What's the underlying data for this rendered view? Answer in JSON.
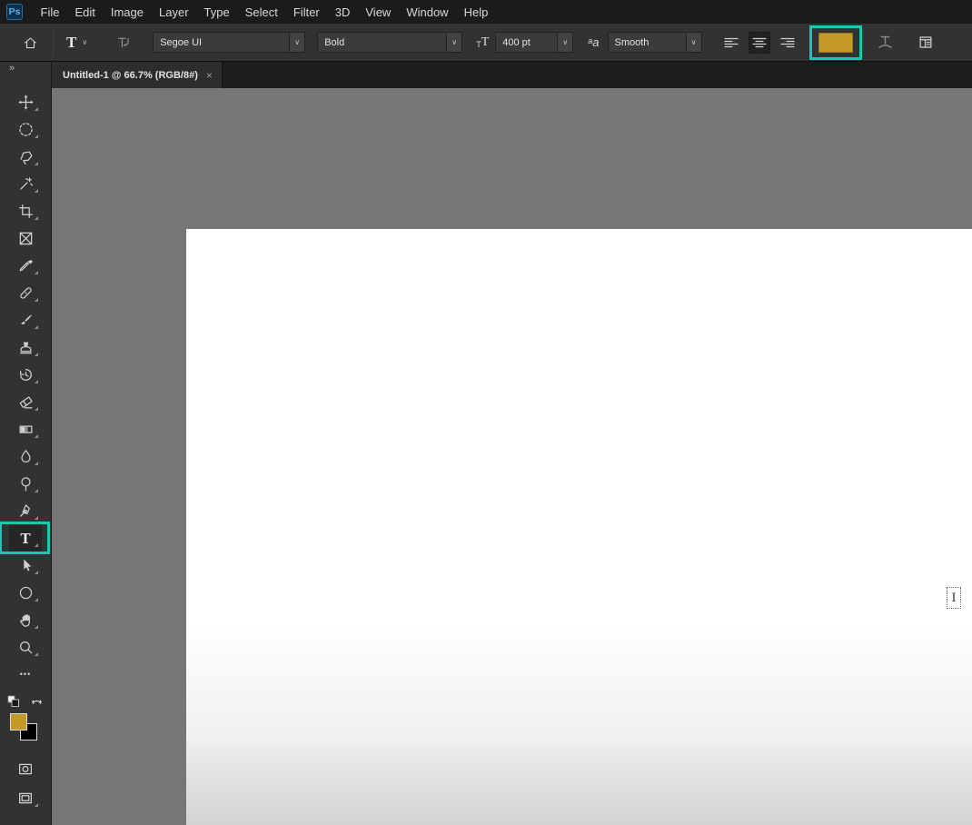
{
  "app": {
    "logo_text": "Ps",
    "window_bg": "#1d1d1d",
    "panel_bg": "#323232",
    "canvas_bg": "#767676",
    "highlight_teal": "#19c7b6"
  },
  "menu_bar": {
    "items": [
      "File",
      "Edit",
      "Image",
      "Layer",
      "Type",
      "Select",
      "Filter",
      "3D",
      "View",
      "Window",
      "Help"
    ]
  },
  "options_bar": {
    "type_tool_glyph": "T",
    "chevron_glyph": "∨",
    "font_family_value": "Segoe UI",
    "font_style_value": "Bold",
    "size_icon_small": "T",
    "size_icon_large": "T",
    "font_size_value": "400 pt",
    "anti_alias_icon_small": "a",
    "anti_alias_icon_large": "a",
    "anti_alias_value": "Smooth",
    "alignment_active": "center",
    "text_color_hex": "#c49a26"
  },
  "tab_bar": {
    "collapse_glyph": "»",
    "tab_title": "Untitled-1 @ 66.7% (RGB/8#)",
    "close_glyph": "×"
  },
  "toolbar": {
    "tools": [
      "move-tool",
      "elliptical-marquee-tool",
      "polygonal-lasso-tool",
      "quick-selection-tool",
      "crop-tool",
      "frame-tool",
      "eyedropper-tool",
      "spot-healing-brush-tool",
      "brush-tool",
      "clone-stamp-tool",
      "history-brush-tool",
      "eraser-tool",
      "gradient-tool",
      "blur-tool",
      "dodge-tool",
      "pen-tool",
      "type-tool",
      "path-selection-tool",
      "ellipse-tool",
      "hand-tool",
      "zoom-tool",
      "edit-toolbar"
    ],
    "active_tool": "type-tool",
    "type_tool_glyph": "T",
    "more_tools_glyph": "•••",
    "foreground_color_hex": "#c49a26",
    "background_color_hex": "#000000"
  },
  "canvas": {
    "cursor_glyph": "I"
  }
}
